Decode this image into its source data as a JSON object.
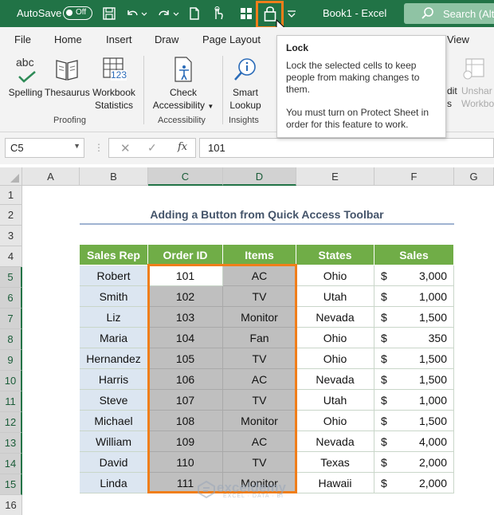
{
  "titlebar": {
    "autosave_label": "AutoSave",
    "autosave_state": "Off",
    "doc_title": "Book1  -  Excel",
    "search_label": "Search (Alt+",
    "qat_icons": [
      "save-icon",
      "undo-icon",
      "redo-icon",
      "new-file-icon",
      "touch-mode-icon",
      "grid-icon",
      "lock-icon",
      "customize-qat-icon"
    ]
  },
  "tabs": [
    "File",
    "Home",
    "Insert",
    "Draw",
    "Page Layout",
    "View"
  ],
  "ribbon": {
    "spelling": {
      "label": "Spelling",
      "icon_text": "abc"
    },
    "thesaurus": {
      "label": "Thesaurus"
    },
    "workbook_stats": {
      "line1": "Workbook",
      "line2": "Statistics",
      "icon_text": "123"
    },
    "check_accessibility": {
      "line1": "Check",
      "line2": "Accessibility"
    },
    "smart_lookup": {
      "line1": "Smart",
      "line2": "Lookup"
    },
    "edit_partial": {
      "line1": "dit",
      "line2": "s"
    },
    "unshare_partial": {
      "line1": "Unshar",
      "line2": "Workbo"
    },
    "groups": {
      "proofing": "Proofing",
      "accessibility": "Accessibility",
      "insights": "Insights"
    }
  },
  "tooltip": {
    "title": "Lock",
    "body": "Lock the selected cells to keep people from making changes to them.",
    "note": "You must turn on Protect Sheet in order for this feature to work."
  },
  "formula_bar": {
    "name_box": "C5",
    "formula": "101",
    "fx": "fx"
  },
  "columns": [
    "A",
    "B",
    "C",
    "D",
    "E",
    "F",
    "G"
  ],
  "rows": [
    "1",
    "2",
    "3",
    "4",
    "5",
    "6",
    "7",
    "8",
    "9",
    "10",
    "11",
    "12",
    "13",
    "14",
    "15",
    "16"
  ],
  "sheet_title": "Adding a Button from Quick Access Toolbar",
  "table": {
    "headers": [
      "Sales Rep",
      "Order ID",
      "Items",
      "States",
      "Sales"
    ],
    "currency": "$",
    "rows": [
      {
        "rep": "Robert",
        "id": "101",
        "item": "AC",
        "state": "Ohio",
        "sales": "3,000"
      },
      {
        "rep": "Smith",
        "id": "102",
        "item": "TV",
        "state": "Utah",
        "sales": "1,000"
      },
      {
        "rep": "Liz",
        "id": "103",
        "item": "Monitor",
        "state": "Nevada",
        "sales": "1,500"
      },
      {
        "rep": "Maria",
        "id": "104",
        "item": "Fan",
        "state": "Ohio",
        "sales": "350"
      },
      {
        "rep": "Hernandez",
        "id": "105",
        "item": "TV",
        "state": "Ohio",
        "sales": "1,500"
      },
      {
        "rep": "Harris",
        "id": "106",
        "item": "AC",
        "state": "Nevada",
        "sales": "1,500"
      },
      {
        "rep": "Steve",
        "id": "107",
        "item": "TV",
        "state": "Utah",
        "sales": "1,000"
      },
      {
        "rep": "Michael",
        "id": "108",
        "item": "Monitor",
        "state": "Ohio",
        "sales": "1,500"
      },
      {
        "rep": "William",
        "id": "109",
        "item": "AC",
        "state": "Nevada",
        "sales": "4,000"
      },
      {
        "rep": "David",
        "id": "110",
        "item": "TV",
        "state": "Texas",
        "sales": "2,000"
      },
      {
        "rep": "Linda",
        "id": "111",
        "item": "Monitor",
        "state": "Hawaii",
        "sales": "2,000"
      }
    ]
  },
  "watermark": {
    "name": "exceldemy",
    "sub": "EXCEL · DATA · BI"
  },
  "colors": {
    "excel_green": "#217346",
    "header_green": "#70ad47",
    "highlight_orange": "#f07e1a",
    "rep_blue": "#dce6f1",
    "locked_gray": "#bfbfbf"
  }
}
